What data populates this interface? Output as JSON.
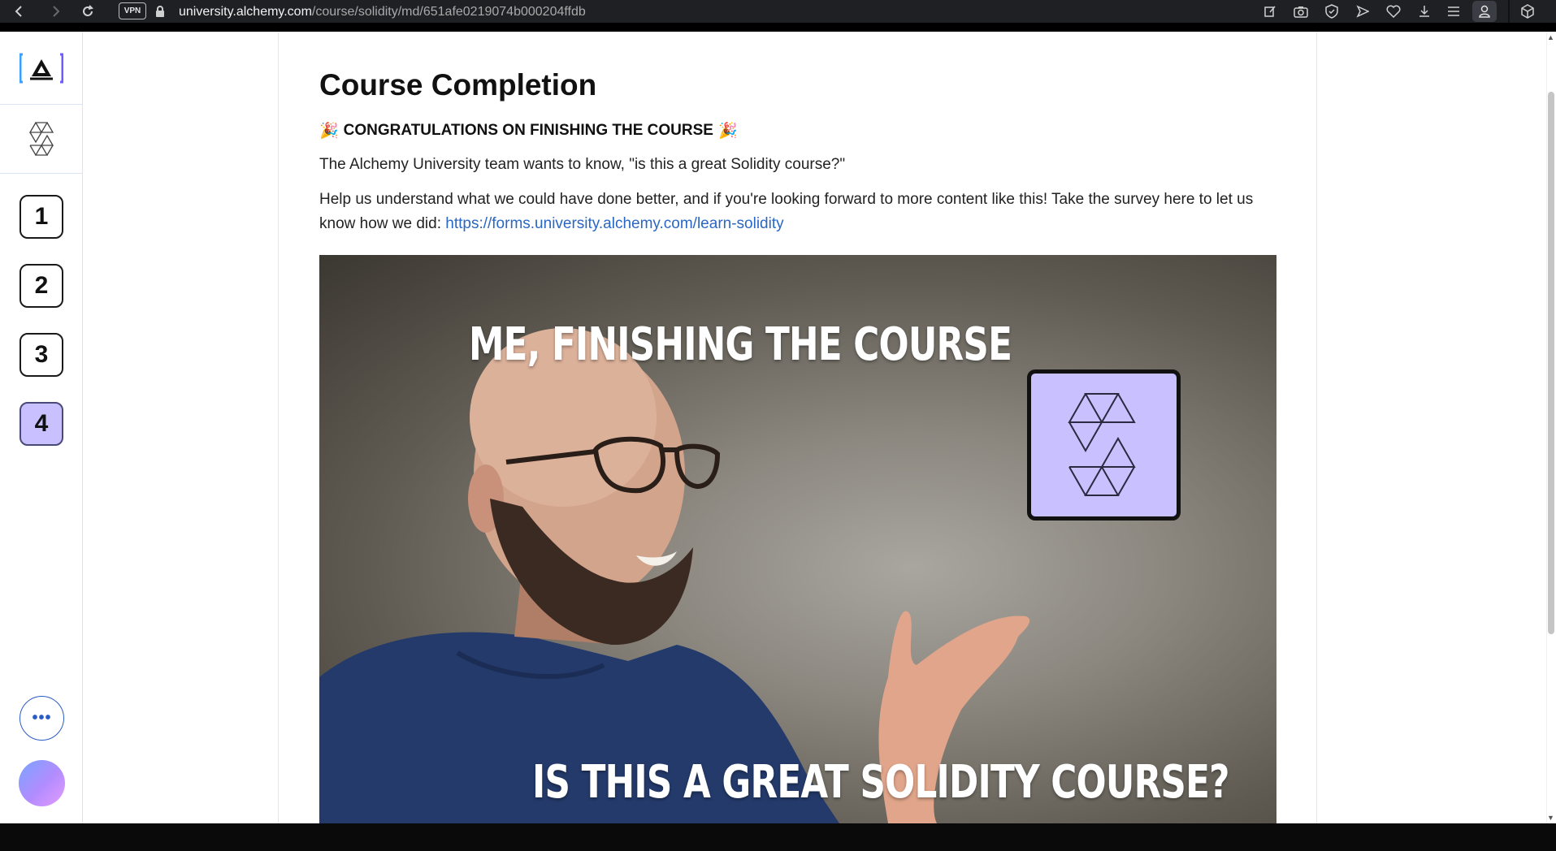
{
  "browser": {
    "vpn_label": "VPN",
    "url_host": "university.alchemy.com",
    "url_path": "/course/solidity/md/651afe0219074b000204ffdb"
  },
  "sidebar": {
    "logo_icon": "alchemy-logo-icon",
    "course_icon": "solidity-logo-icon",
    "sections": [
      {
        "label": "1"
      },
      {
        "label": "2"
      },
      {
        "label": "3"
      },
      {
        "label": "4",
        "active": true
      }
    ],
    "more_label": "•••"
  },
  "main": {
    "title": "Course Completion",
    "congrats": "CONGRATULATIONS ON FINISHING THE COURSE",
    "congrats_emoji": "🎉",
    "intro": "The Alchemy University team wants to know, \"is this a great Solidity course?\"",
    "survey_text": "Help us understand what we could have done better, and if you're looking forward to more content like this! Take the survey here to let us know how we did: ",
    "survey_link": "https://forms.university.alchemy.com/learn-solidity",
    "meme": {
      "top_caption": "ME, FINISHING THE COURSE",
      "bottom_caption": "IS THIS A GREAT SOLIDITY COURSE?"
    }
  },
  "colors": {
    "active_section": "#c9c1ff",
    "link": "#2a67c3",
    "meme_logo_bg": "#c8c0ff"
  }
}
